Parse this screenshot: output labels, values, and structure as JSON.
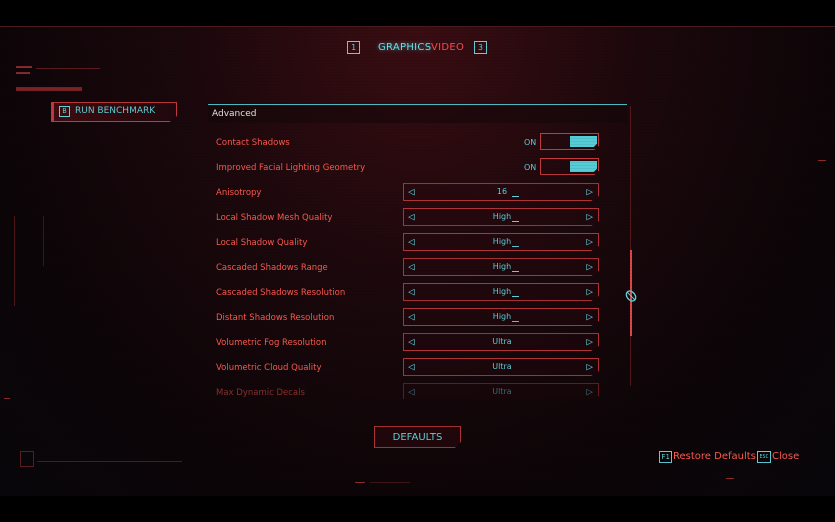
{
  "tabs": {
    "prev_key": "1",
    "active_label": "GRAPHICS",
    "inactive_label": "VIDEO",
    "next_key": "3"
  },
  "benchmark": {
    "key": "B",
    "label": "RUN BENCHMARK"
  },
  "panel": {
    "section_title": "Advanced",
    "toggles": [
      {
        "label": "Contact Shadows",
        "value": "ON"
      },
      {
        "label": "Improved Facial Lighting Geometry",
        "value": "ON"
      }
    ],
    "selectors": [
      {
        "label": "Anisotropy",
        "value": "16"
      },
      {
        "label": "Local Shadow Mesh Quality",
        "value": "High"
      },
      {
        "label": "Local Shadow Quality",
        "value": "High"
      },
      {
        "label": "Cascaded Shadows Range",
        "value": "High"
      },
      {
        "label": "Cascaded Shadows Resolution",
        "value": "High"
      },
      {
        "label": "Distant Shadows Resolution",
        "value": "High"
      },
      {
        "label": "Volumetric Fog Resolution",
        "value": "Ultra"
      },
      {
        "label": "Volumetric Cloud Quality",
        "value": "Ultra"
      },
      {
        "label": "Max Dynamic Decals",
        "value": "Ultra"
      }
    ]
  },
  "defaults_button": "DEFAULTS",
  "footer": {
    "restore_key": "F1",
    "restore_label": "Restore Defaults",
    "close_key": "ESC",
    "close_label": "Close"
  },
  "colors": {
    "accent_cyan": "#5fd0d8",
    "accent_red": "#ff5a50",
    "border_red": "#b03338"
  },
  "icons": {
    "left_arrow": "triangle-left-icon",
    "right_arrow": "triangle-right-icon",
    "scroll": "mouse-scroll-icon"
  }
}
